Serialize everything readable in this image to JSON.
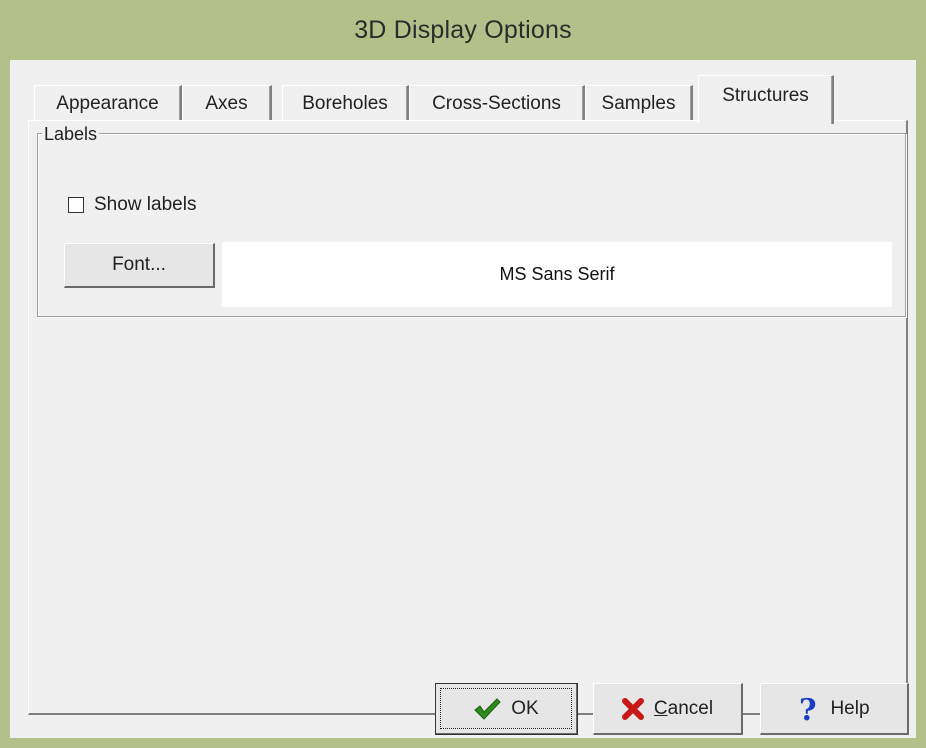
{
  "window": {
    "title": "3D Display Options"
  },
  "tabs": [
    {
      "label": "Appearance",
      "active": false
    },
    {
      "label": "Axes",
      "active": false
    },
    {
      "label": "Boreholes",
      "active": false
    },
    {
      "label": "Cross-Sections",
      "active": false
    },
    {
      "label": "Samples",
      "active": false
    },
    {
      "label": "Structures",
      "active": true
    }
  ],
  "labels_group": {
    "legend": "Labels",
    "show_labels": {
      "label": "Show labels",
      "checked": false
    },
    "font_button": "Font...",
    "font_preview": "MS Sans Serif"
  },
  "footer": {
    "ok": "OK",
    "cancel": "Cancel",
    "help": "Help"
  },
  "icons": {
    "ok": "checkmark-icon",
    "cancel": "x-icon",
    "help": "question-mark-icon"
  },
  "colors": {
    "title_bar": "#b4c08a",
    "panel": "#f0f0f0",
    "ok_check": "#2e8b1e",
    "cancel_x": "#c81818",
    "help_q": "#1a3fc4"
  }
}
